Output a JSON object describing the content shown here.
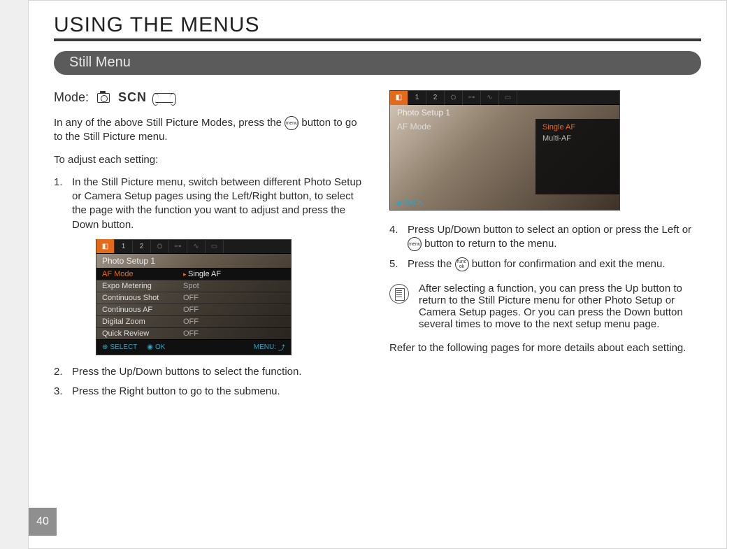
{
  "page_number": "40",
  "heading": "USING THE MENUS",
  "section": "Still Menu",
  "mode_label": "Mode:",
  "mode_scn": "SCN",
  "intro_a": "In any of the above Still Picture Modes, press the ",
  "intro_b": " button to go to the Still Picture menu.",
  "adjust_label": "To adjust each setting:",
  "step1": "In the Still Picture menu, switch between different Photo Setup or Camera Setup pages using the Left/Right button, to select the page with the function you want to adjust and press the Down button.",
  "step2": "Press the Up/Down buttons to select the function.",
  "step3": "Press the Right button to go to the submenu.",
  "step4_a": "Press Up/Down button to select an option or press the Left or ",
  "step4_b": " button to return to the menu.",
  "step5_a": "Press the ",
  "step5_b": " button for confirmation and exit the menu.",
  "note": "After selecting a function, you can press the Up button to return to the Still Picture menu for other Photo Setup or Camera Setup pages. Or you can press the Down button several times to move to the next setup menu page.",
  "refer": "Refer to the following pages for more details about each setting.",
  "btn_menu": "menu",
  "btn_func": "func ok",
  "lcd1": {
    "tabs": [
      "📷",
      "1",
      "2",
      "⚙",
      "⚙",
      "∿",
      "▭"
    ],
    "header": "Photo Setup 1",
    "rows": [
      {
        "label": "AF Mode",
        "value": "Single AF",
        "sel": true
      },
      {
        "label": "Expo Metering",
        "value": "Spot"
      },
      {
        "label": "Continuous Shot",
        "value": "OFF"
      },
      {
        "label": "Continuous AF",
        "value": "OFF"
      },
      {
        "label": "Digital Zoom",
        "value": "OFF"
      },
      {
        "label": "Quick Review",
        "value": "OFF"
      }
    ],
    "foot_select": "SELECT",
    "foot_ok": "OK",
    "foot_menu": "MENU:"
  },
  "lcd2": {
    "header": "Photo Setup 1",
    "afmode": "AF Mode",
    "options": [
      "Single AF",
      "Multi-AF"
    ],
    "back": "BACK"
  }
}
